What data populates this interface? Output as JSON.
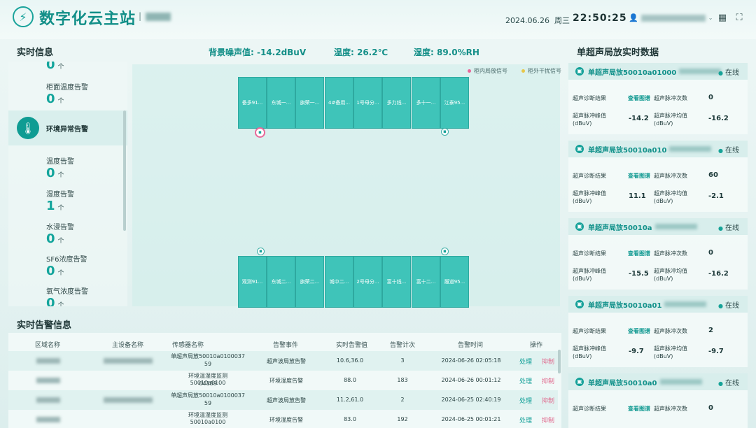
{
  "header": {
    "title": "数字化云主站",
    "date": "2024.06.26",
    "weekday": "周三",
    "time": "22:50:25",
    "logo_icon": "lightning-icon",
    "user_icon": "user-icon",
    "grid_icon": "grid-icon",
    "fullscreen_icon": "fullscreen-icon"
  },
  "realtime_info": {
    "title": "实时信息",
    "top_value": "0",
    "top_unit": "个",
    "cabinet_temp": {
      "label": "柜面温度告警",
      "value": "0",
      "unit": "个"
    },
    "env_group": {
      "label": "环境异常告警",
      "icon": "thermometer-icon"
    },
    "items": [
      {
        "label": "温度告警",
        "value": "0",
        "unit": "个"
      },
      {
        "label": "湿度告警",
        "value": "1",
        "unit": "个"
      },
      {
        "label": "水浸告警",
        "value": "0",
        "unit": "个"
      },
      {
        "label": "SF6浓度告警",
        "value": "0",
        "unit": "个"
      },
      {
        "label": "氧气浓度告警",
        "value": "0",
        "unit": "个"
      }
    ]
  },
  "env_readings": {
    "noise": "背景噪声值: -14.2dBuV",
    "temperature": "温度: 26.2℃",
    "humidity": "湿度: 89.0%RH"
  },
  "legend": {
    "inner": "柜内局放信号",
    "outer": "柜外干扰信号",
    "inner_color": "#e8689a",
    "outer_color": "#e8c84a"
  },
  "cabinets_top": [
    "备多91...",
    "东城一...",
    "旗荣一...",
    "4#备用...",
    "1号母分...",
    "多力线...",
    "多十一...",
    "江泰95..."
  ],
  "cabinets_bottom": [
    "观测91...",
    "东城二...",
    "旗荣二...",
    "城中二...",
    "2号母分...",
    "富十线...",
    "富十二...",
    "履道95..."
  ],
  "right_panel": {
    "title": "单超声局放实时数据",
    "cards": [
      {
        "name": "单超声局放50010a01000",
        "status": "在线",
        "diag_label": "超声诊断结果",
        "diag_link": "查看图谱",
        "count_label": "超声脉冲次数",
        "count": "0",
        "peak_label": "超声脉冲峰值\n(dBuV)",
        "peak": "-14.2",
        "avg_label": "超声脉冲均值\n(dBuV)",
        "avg": "-16.2"
      },
      {
        "name": "单超声局放50010a010",
        "status": "在线",
        "diag_label": "超声诊断结果",
        "diag_link": "查看图谱",
        "count_label": "超声脉冲次数",
        "count": "60",
        "peak_label": "超声脉冲峰值\n(dBuV)",
        "peak": "11.1",
        "avg_label": "超声脉冲均值\n(dBuV)",
        "avg": "-2.1"
      },
      {
        "name": "单超声局放50010a",
        "status": "在线",
        "diag_label": "超声诊断结果",
        "diag_link": "查看图谱",
        "count_label": "超声脉冲次数",
        "count": "0",
        "peak_label": "超声脉冲峰值\n(dBuV)",
        "peak": "-15.5",
        "avg_label": "超声脉冲均值\n(dBuV)",
        "avg": "-16.2"
      },
      {
        "name": "单超声局放50010a01",
        "status": "在线",
        "diag_label": "超声诊断结果",
        "diag_link": "查看图谱",
        "count_label": "超声脉冲次数",
        "count": "2",
        "peak_label": "超声脉冲峰值\n(dBuV)",
        "peak": "-9.7",
        "avg_label": "超声脉冲均值\n(dBuV)",
        "avg": "-9.7"
      },
      {
        "name": "单超声局放50010a0",
        "status": "在线",
        "diag_label": "超声诊断结果",
        "diag_link": "查看图谱",
        "count_label": "超声脉冲次数",
        "count": "0"
      }
    ]
  },
  "alarm_table": {
    "title": "实时告警信息",
    "columns": [
      "区域名称",
      "主设备名称",
      "传感器名称",
      "告警事件",
      "实时告警值",
      "告警计次",
      "告警时间",
      "操作"
    ],
    "rows": [
      {
        "sensor_l1": "单超声局放50010a0100037",
        "sensor_l2": "59",
        "event": "超声波局放告警",
        "value": "10.6,36.0",
        "count": "3",
        "time": "2024-06-26 02:05:18",
        "op1": "处理",
        "op2": "抑制"
      },
      {
        "sensor_l1": "环境温湿度监测50010a0100",
        "sensor_l2": "04189",
        "event": "环境湿度告警",
        "value": "88.0",
        "count": "183",
        "time": "2024-06-26 00:01:12",
        "op1": "处理",
        "op2": "抑制"
      },
      {
        "sensor_l1": "单超声局放50010a0100037",
        "sensor_l2": "59",
        "event": "超声波局放告警",
        "value": "11.2,61.0",
        "count": "2",
        "time": "2024-06-25 02:40:19",
        "op1": "处理",
        "op2": "抑制"
      },
      {
        "sensor_l1": "环境温湿度监测50010a0100",
        "sensor_l2": "",
        "event": "环境湿度告警",
        "value": "83.0",
        "count": "192",
        "time": "2024-06-25 00:01:21",
        "op1": "处理",
        "op2": "抑制"
      }
    ]
  }
}
